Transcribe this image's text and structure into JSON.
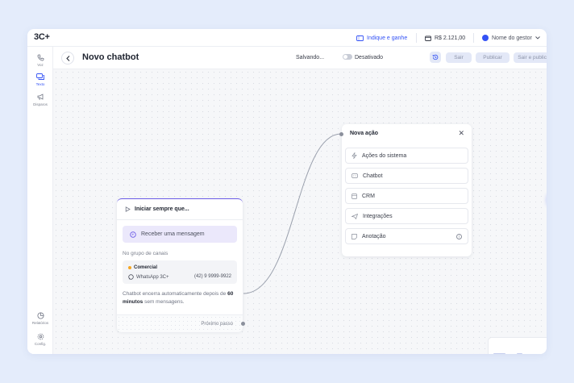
{
  "app": {
    "logo": "3C+"
  },
  "topbar": {
    "referral_label": "Indique e ganhe",
    "balance": "R$ 2.121,00",
    "manager_name": "Nome do gestor",
    "accent": "#3352f5"
  },
  "sidebar": {
    "items": [
      {
        "label": "Voz",
        "icon": "phone-icon"
      },
      {
        "label": "Texto",
        "icon": "chat-icon"
      },
      {
        "label": "Disparos",
        "icon": "megaphone-icon"
      }
    ],
    "bottom": [
      {
        "label": "Relatórios",
        "icon": "reports-icon"
      },
      {
        "label": "Config.",
        "icon": "gear-icon"
      }
    ]
  },
  "header": {
    "title": "Novo chatbot",
    "status": "Salvando...",
    "toggle_label": "Desativado",
    "buttons": {
      "exit": "Sair",
      "publish": "Publicar",
      "exit_publish": "Sair e publicar"
    }
  },
  "start_node": {
    "title": "Iniciar sempre que...",
    "trigger": "Receber uma mensagem",
    "group_label": "No grupo de canais",
    "channel_group": "Comercial",
    "channel_name": "WhatsApp 3C+",
    "channel_phone": "(42) 9 9999-9922",
    "info_prefix": "Chatbot encerra automaticamente depois de ",
    "info_bold": "60 minutos",
    "info_suffix": " sem mensagens.",
    "next_step": "Próximo passo"
  },
  "action_node": {
    "title": "Nova ação",
    "items": [
      {
        "label": "Ações do sistema",
        "icon": "lightning-icon"
      },
      {
        "label": "Chatbot",
        "icon": "chatbot-icon"
      },
      {
        "label": "CRM",
        "icon": "crm-icon"
      },
      {
        "label": "Integrações",
        "icon": "send-icon"
      },
      {
        "label": "Anotação",
        "icon": "note-icon"
      }
    ]
  }
}
